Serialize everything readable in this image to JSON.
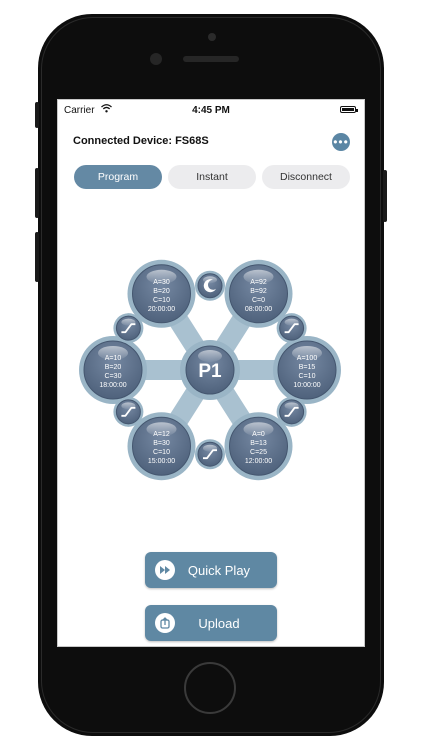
{
  "status_bar": {
    "carrier": "Carrier",
    "time": "4:45 PM"
  },
  "header": {
    "title": "Connected Device: FS68S",
    "more_icon": "ellipsis-icon"
  },
  "tabs": [
    {
      "label": "Program",
      "active": true
    },
    {
      "label": "Instant",
      "active": false
    },
    {
      "label": "Disconnect",
      "active": false
    }
  ],
  "hub": {
    "center_label": "P1",
    "nodes": [
      {
        "lines": [
          "A=30",
          "B=20",
          "C=10",
          "20:00:00"
        ]
      },
      {
        "lines": [
          "A=92",
          "B=92",
          "C=0",
          "08:00:00"
        ]
      },
      {
        "lines": [
          "A=100",
          "B=15",
          "C=10",
          "10:00:00"
        ]
      },
      {
        "lines": [
          "A=0",
          "B=13",
          "C=25",
          "12:00:00"
        ]
      },
      {
        "lines": [
          "A=12",
          "B=30",
          "C=10",
          "15:00:00"
        ]
      },
      {
        "lines": [
          "A=10",
          "B=20",
          "C=30",
          "18:00:00"
        ]
      }
    ],
    "connectors": [
      "moon-icon",
      "ramp-icon",
      "ramp-icon",
      "ramp-icon",
      "ramp-icon",
      "ramp-icon"
    ]
  },
  "actions": {
    "quick_play": {
      "label": "Quick Play",
      "icon": "fast-forward-icon"
    },
    "upload": {
      "label": "Upload",
      "icon": "upload-icon"
    }
  },
  "colors": {
    "accent": "#5f88a3",
    "node": "#5c6e87",
    "ring": "#9ab5c6",
    "spoke": "#a9c1d0"
  }
}
